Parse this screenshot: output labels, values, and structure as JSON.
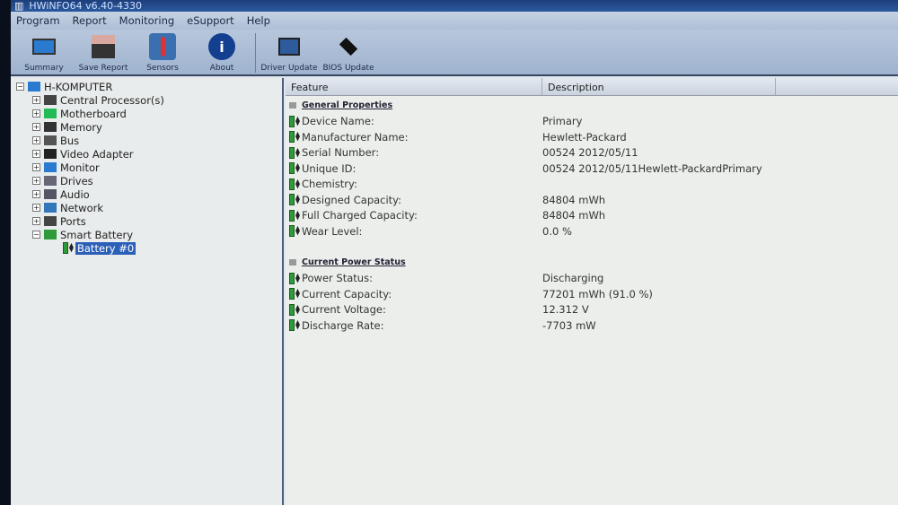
{
  "title": "HWiNFO64 v6.40-4330",
  "menu": [
    "Program",
    "Report",
    "Monitoring",
    "eSupport",
    "Help"
  ],
  "toolbar": [
    "Summary",
    "Save Report",
    "Sensors",
    "About",
    "Driver Update",
    "BIOS Update"
  ],
  "tree": {
    "root": "H-KOMPUTER",
    "items": [
      "Central Processor(s)",
      "Motherboard",
      "Memory",
      "Bus",
      "Video Adapter",
      "Monitor",
      "Drives",
      "Audio",
      "Network",
      "Ports",
      "Smart Battery"
    ],
    "child": "Battery #0"
  },
  "columns": [
    "Feature",
    "Description"
  ],
  "sections": [
    {
      "title": "General Properties",
      "rows": [
        [
          "Device Name:",
          "Primary"
        ],
        [
          "Manufacturer Name:",
          "Hewlett-Packard"
        ],
        [
          "Serial Number:",
          "00524 2012/05/11"
        ],
        [
          "Unique ID:",
          "00524 2012/05/11Hewlett-PackardPrimary"
        ],
        [
          "Chemistry:",
          ""
        ],
        [
          "Designed Capacity:",
          "84804 mWh"
        ],
        [
          "Full Charged Capacity:",
          "84804 mWh"
        ],
        [
          "Wear Level:",
          "0.0 %"
        ]
      ]
    },
    {
      "title": "Current Power Status",
      "rows": [
        [
          "Power Status:",
          "Discharging"
        ],
        [
          "Current Capacity:",
          "77201 mWh (91.0 %)"
        ],
        [
          "Current Voltage:",
          "12.312 V"
        ],
        [
          "Discharge Rate:",
          "-7703 mW"
        ]
      ]
    }
  ]
}
